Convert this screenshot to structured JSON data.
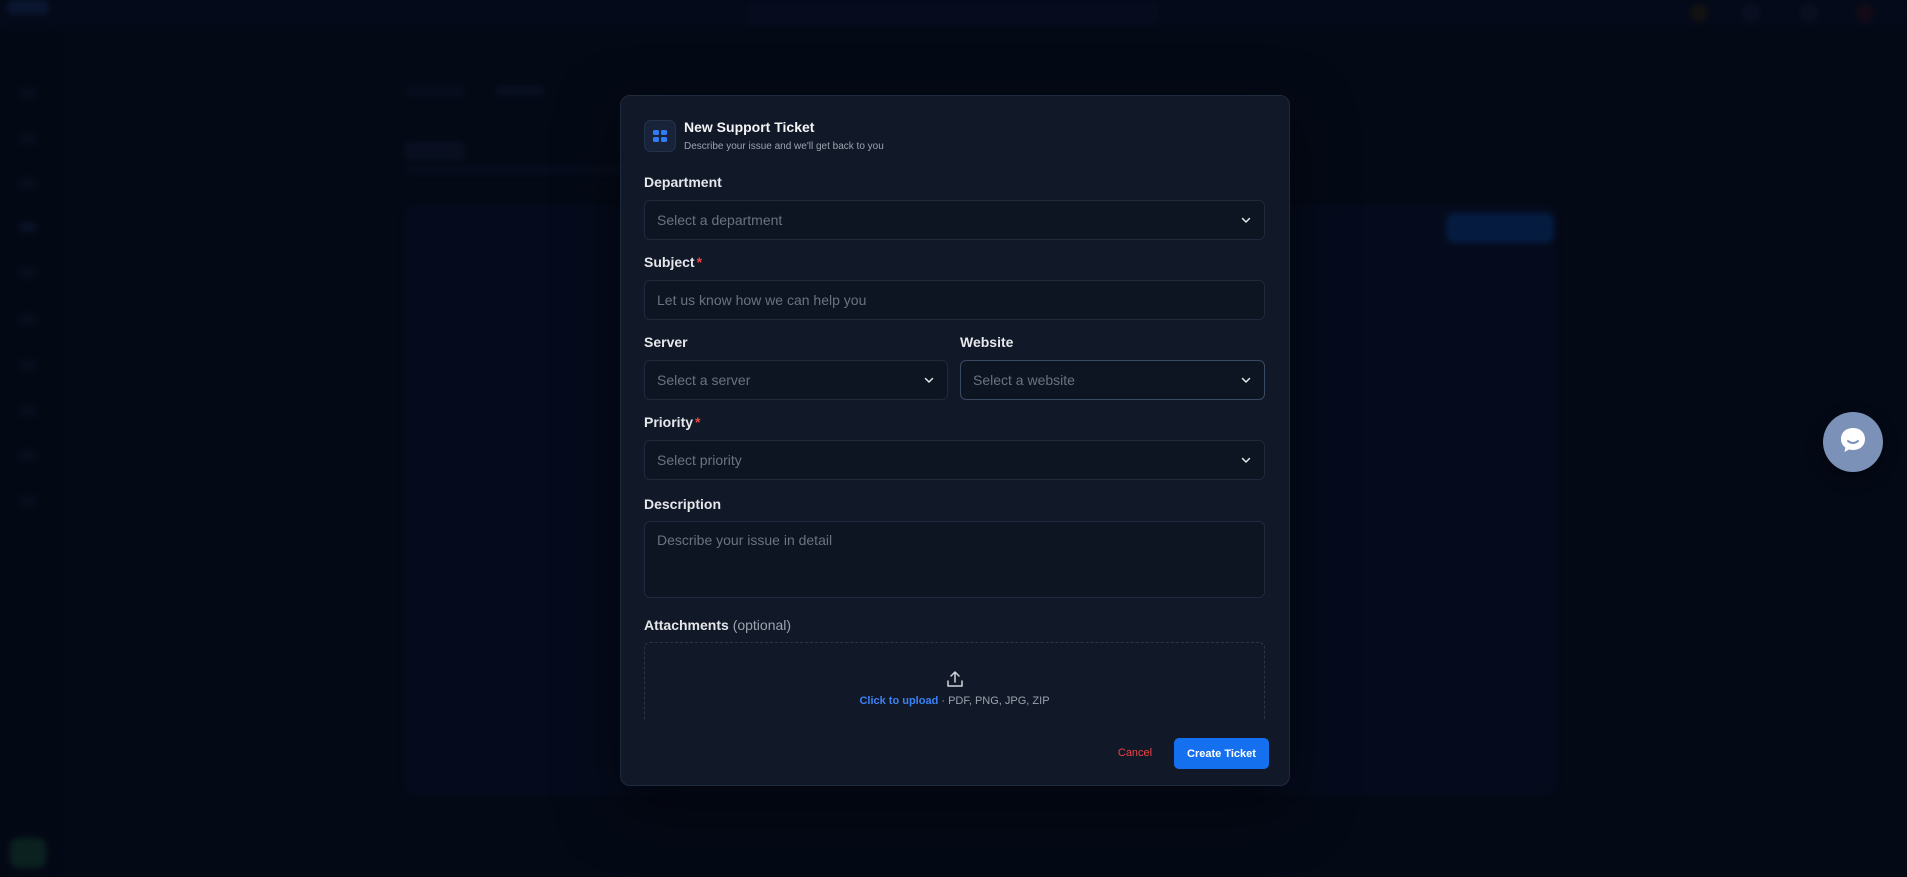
{
  "modal": {
    "title": "New Support Ticket",
    "subtitle": "Describe your issue and we'll get back to you",
    "icon": "support-ticket-icon"
  },
  "fields": {
    "department": {
      "label": "Department",
      "placeholder": "Select a department"
    },
    "subject": {
      "label": "Subject",
      "required_mark": "*",
      "placeholder": "Let us know how we can help you"
    },
    "server": {
      "label": "Server",
      "placeholder": "Select a server"
    },
    "website": {
      "label": "Website",
      "placeholder": "Select a website"
    },
    "priority": {
      "label": "Priority",
      "required_mark": "*",
      "placeholder": "Select priority"
    },
    "description": {
      "label": "Description",
      "placeholder": "Describe your issue in detail"
    }
  },
  "attachments": {
    "label": "Attachments",
    "optional": "(optional)",
    "upload_link": "Click to upload",
    "upload_types": " · PDF, PNG, JPG, ZIP"
  },
  "actions": {
    "cancel": "Cancel",
    "create": "Create Ticket"
  },
  "colors": {
    "accent": "#1570ef",
    "danger": "#ef4444",
    "modal_bg": "#111827",
    "page_bg": "#060b1c",
    "chat_bubble": "#7b91b7"
  }
}
